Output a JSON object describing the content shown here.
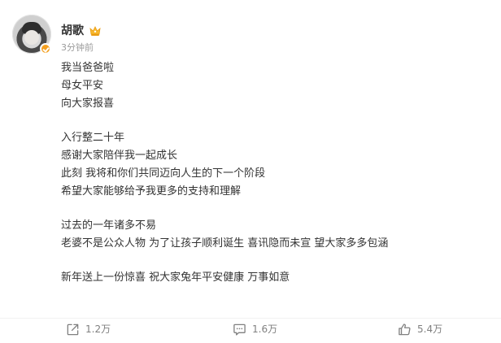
{
  "post": {
    "author": {
      "name": "胡歌"
    },
    "time": "3分钟前",
    "content": [
      [
        "我当爸爸啦",
        "母女平安",
        "向大家报喜"
      ],
      [
        "入行整二十年",
        "感谢大家陪伴我一起成长",
        "此刻 我将和你们共同迈向人生的下一个阶段",
        "希望大家能够给予我更多的支持和理解"
      ],
      [
        "过去的一年诸多不易",
        "老婆不是公众人物 为了让孩子顺利诞生 喜讯隐而未宣 望大家多多包涵"
      ],
      [
        "新年送上一份惊喜 祝大家兔年平安健康 万事如意"
      ]
    ]
  },
  "actions": {
    "share": {
      "count": "1.2万",
      "icon": "share-icon"
    },
    "comment": {
      "count": "1.6万",
      "icon": "comment-icon"
    },
    "like": {
      "count": "5.4万",
      "icon": "thumbs-up-icon"
    }
  },
  "colors": {
    "text": "#333333",
    "muted": "#9b9b9b",
    "action_text": "#808080",
    "verified_badge": "#f4a020",
    "crown": "#f7b82e"
  }
}
